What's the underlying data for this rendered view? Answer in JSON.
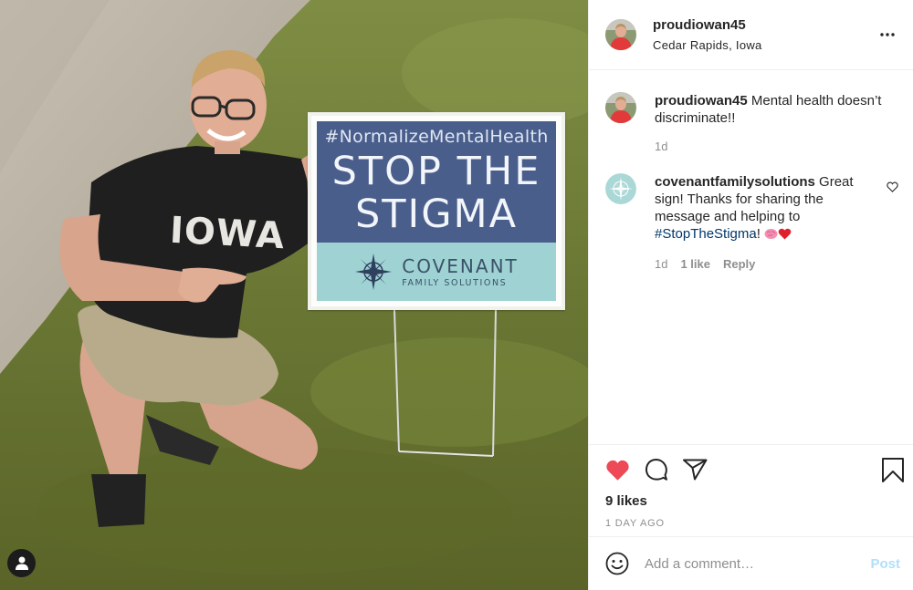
{
  "photo": {
    "alt_sign_hashtag": "#NormalizeMentalHealth",
    "sign_title": "STOP THE STIGMA",
    "sign_brand_name": "COVENANT",
    "sign_brand_sub": "FAMILY SOLUTIONS",
    "shirt_text": "IOWA",
    "user_tag_icon": "person-icon"
  },
  "header": {
    "username": "proudiowan45",
    "location": "Cedar Rapids, Iowa",
    "more_icon": "more-horizontal-icon"
  },
  "comments": [
    {
      "username": "proudiowan45",
      "text": "Mental health doesn’t discriminate!!",
      "time": "1d"
    },
    {
      "username": "covenantfamilysolutions",
      "text_before": "Great sign! Thanks for sharing the message and helping to ",
      "hashtag": "#StopTheStigma",
      "text_after": "!",
      "time": "1d",
      "likes": "1 like",
      "reply": "Reply"
    }
  ],
  "actions": {
    "like_icon": "heart-filled-icon",
    "comment_icon": "comment-icon",
    "share_icon": "share-icon",
    "save_icon": "bookmark-icon",
    "likes": "9 likes",
    "date": "1 DAY AGO"
  },
  "add_comment": {
    "placeholder": "Add a comment…",
    "post_label": "Post",
    "emoji_icon": "smiley-icon"
  },
  "colors": {
    "like_red": "#ed4956",
    "hashtag_blue": "#00376b",
    "post_button_disabled": "#b2dffc",
    "sign_navy": "#4a5e8c",
    "sign_teal": "#9fd3d3"
  }
}
